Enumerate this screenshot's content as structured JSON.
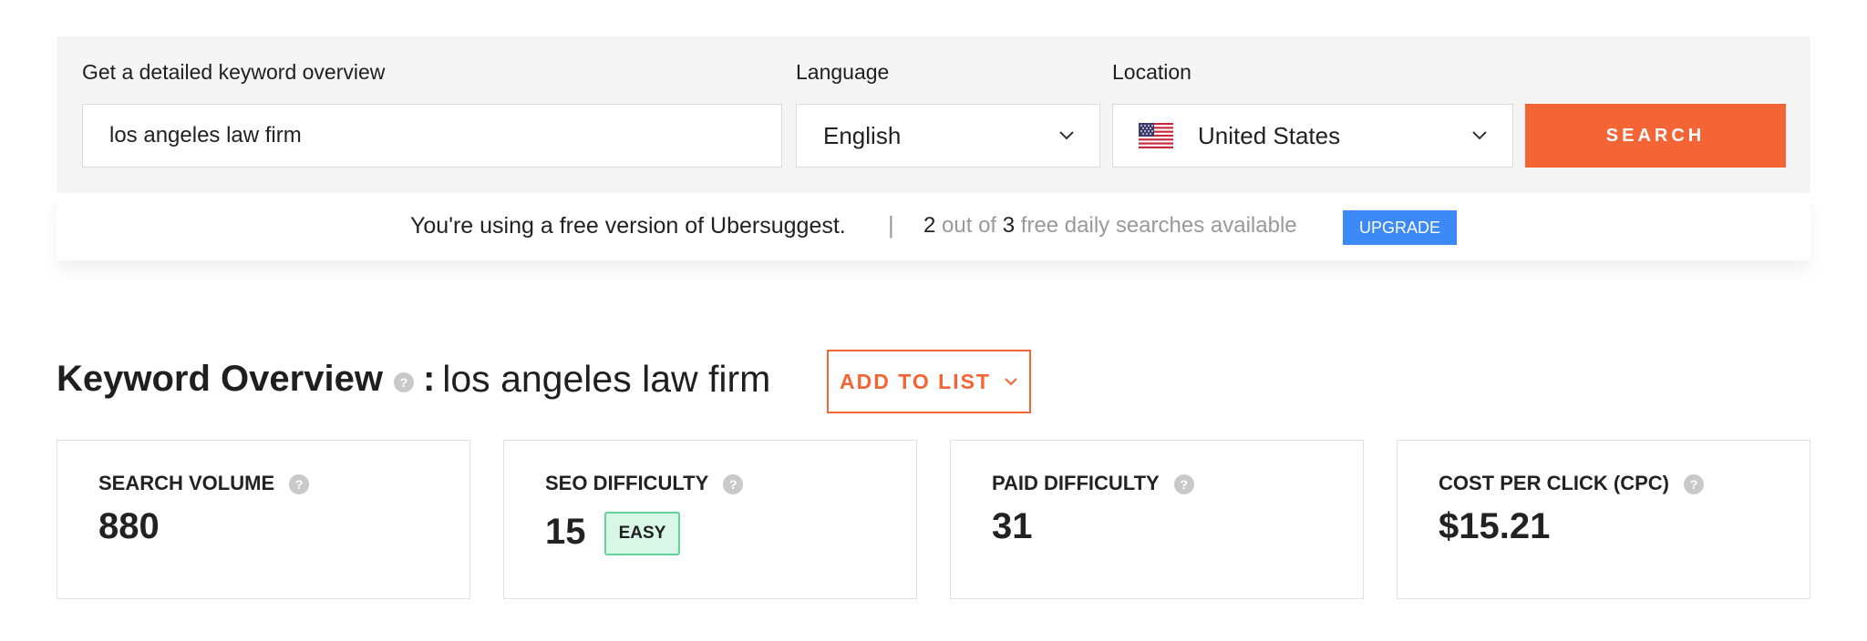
{
  "search": {
    "keyword_label": "Get a detailed keyword overview",
    "keyword_value": "los angeles law firm",
    "language_label": "Language",
    "language_value": "English",
    "location_label": "Location",
    "location_value": "United States",
    "location_flag_icon": "us-flag-icon",
    "button_label": "SEARCH"
  },
  "notice": {
    "text": "You're using a free version of Ubersuggest.",
    "separator": "|",
    "used": "2",
    "out_of_text": "out of",
    "total": "3",
    "suffix": "free daily searches available",
    "upgrade_label": "UPGRADE"
  },
  "overview": {
    "title": "Keyword Overview",
    "help": "?",
    "colon": ":",
    "keyword": "los angeles law firm",
    "add_to_list_label": "ADD TO LIST"
  },
  "metrics": [
    {
      "label": "SEARCH VOLUME",
      "value": "880"
    },
    {
      "label": "SEO DIFFICULTY",
      "value": "15",
      "badge": "EASY"
    },
    {
      "label": "PAID DIFFICULTY",
      "value": "31"
    },
    {
      "label": "COST PER CLICK (CPC)",
      "value": "$15.21"
    }
  ],
  "colors": {
    "accent_orange": "#f46434",
    "upgrade_blue": "#3d89f5",
    "easy_green_bg": "#d9f7e6",
    "easy_green_border": "#63d39a",
    "panel_bg": "#f5f5f5"
  }
}
